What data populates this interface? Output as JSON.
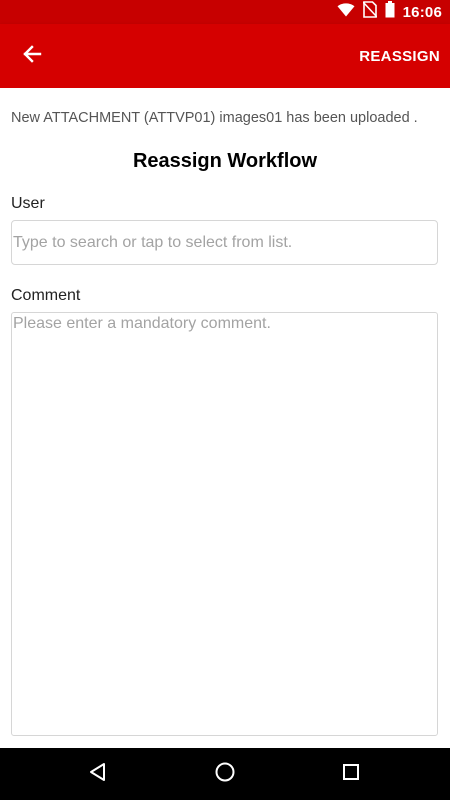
{
  "status_bar": {
    "time": "16:06",
    "icons": [
      "wifi-icon",
      "no-sim-icon",
      "battery-icon"
    ]
  },
  "app_bar": {
    "back_icon": "arrow-left-icon",
    "action_label": "REASSIGN"
  },
  "main": {
    "message": "New ATTACHMENT (ATTVP01) images01 has been uploaded .",
    "title": "Reassign Workflow",
    "user": {
      "label": "User",
      "placeholder": "Type to search or tap to select from list.",
      "value": ""
    },
    "comment": {
      "label": "Comment",
      "placeholder": "Please enter a mandatory comment.",
      "value": ""
    }
  },
  "nav_bar": {
    "icons": [
      "back-triangle-icon",
      "home-circle-icon",
      "recents-square-icon"
    ]
  },
  "colors": {
    "app_bar": "#d50000",
    "status_bar": "#c70000",
    "nav_bar": "#000000"
  }
}
